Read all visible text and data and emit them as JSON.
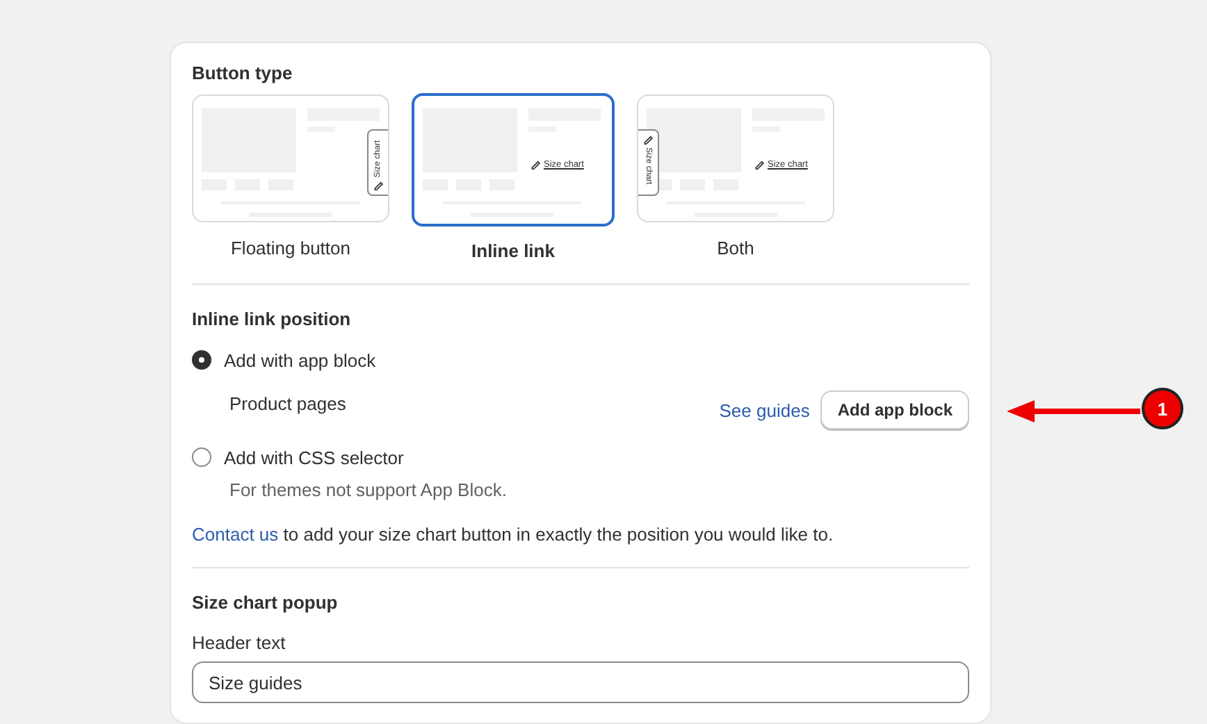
{
  "button_type": {
    "title": "Button type",
    "options": [
      {
        "label": "Floating button",
        "selected": false,
        "kind": "floating",
        "tab_text": "Size chart"
      },
      {
        "label": "Inline link",
        "selected": true,
        "kind": "inline",
        "link_text": "Size chart"
      },
      {
        "label": "Both",
        "selected": false,
        "kind": "both",
        "tab_text": "Size chart",
        "link_text": "Size chart"
      }
    ]
  },
  "inline_link_position": {
    "title": "Inline link position",
    "options": [
      {
        "label": "Add with app block",
        "selected": true,
        "note": "Product pages"
      },
      {
        "label": "Add with CSS selector",
        "selected": false,
        "note": "For themes not support App Block."
      }
    ],
    "see_guides": "See guides",
    "add_button": "Add app block",
    "help": {
      "link": "Contact us",
      "text": " to add your size chart button in exactly the position you would like to."
    }
  },
  "size_chart_popup": {
    "title": "Size chart popup",
    "field_label": "Header text",
    "field_value": "Size guides"
  },
  "annotation": {
    "badge": "1"
  }
}
